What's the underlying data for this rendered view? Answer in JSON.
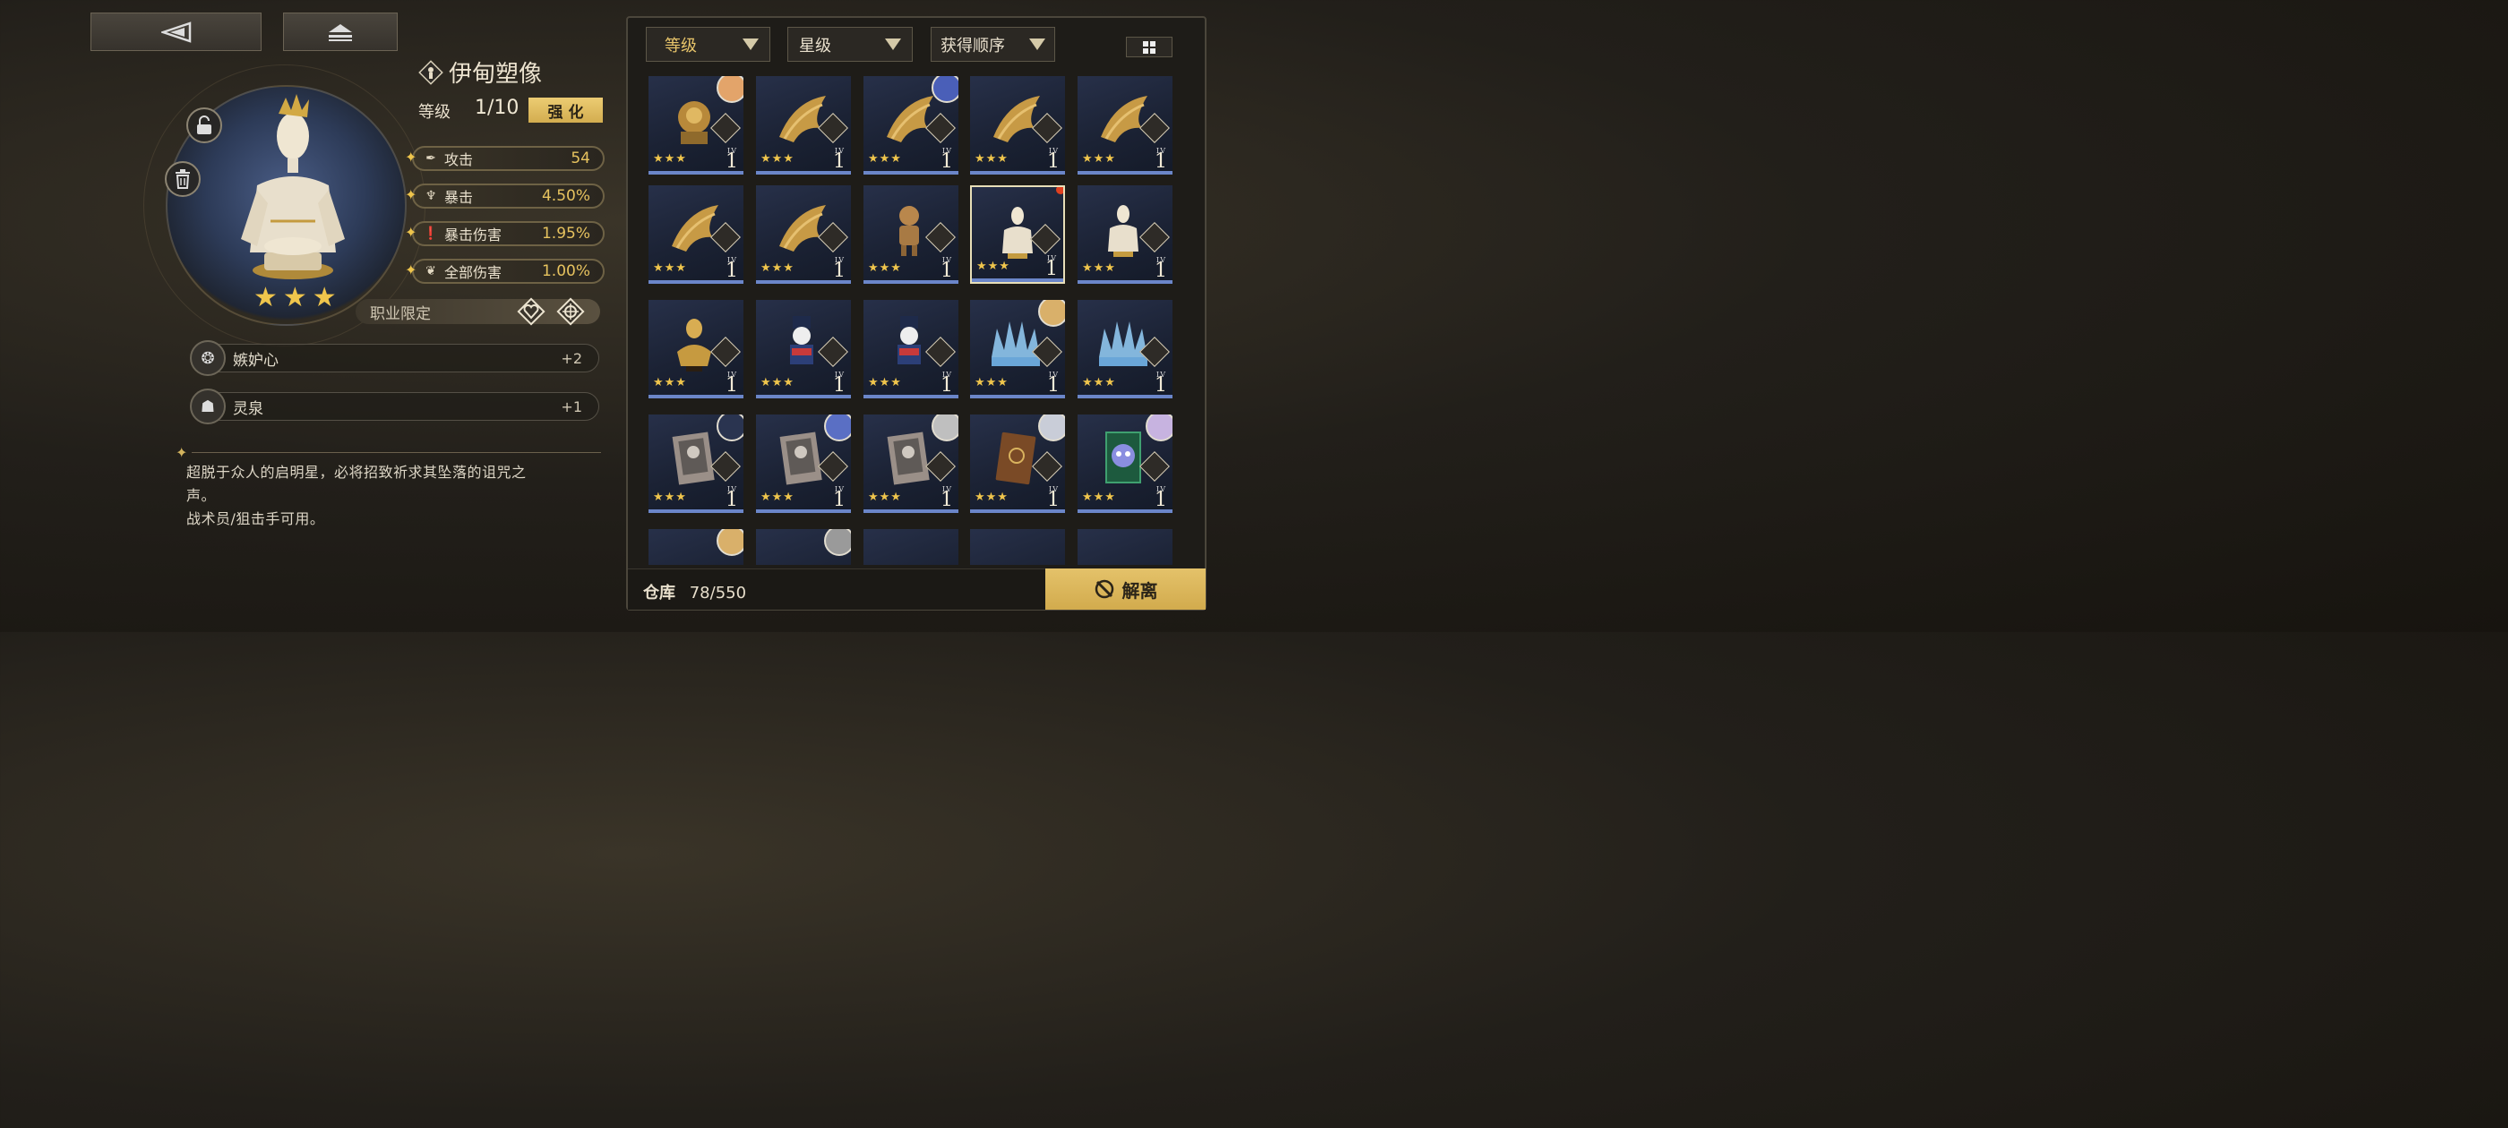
{
  "nav": {
    "back_icon": "triangle-left-icon",
    "home_icon": "eject-icon"
  },
  "item": {
    "name": "伊甸塑像",
    "level_label": "等级",
    "level_value": "1/10",
    "enhance_label": "强 化",
    "stars": 3,
    "stats": [
      {
        "icon": "sword-icon",
        "name": "攻击",
        "value": "54"
      },
      {
        "icon": "crit-icon",
        "name": "暴击",
        "value": "4.50%"
      },
      {
        "icon": "crit-damage-icon",
        "name": "暴击伤害",
        "value": "1.95%"
      },
      {
        "icon": "all-damage-icon",
        "name": "全部伤害",
        "value": "1.00%"
      }
    ],
    "job_label": "职业限定",
    "sub_skills": [
      {
        "icon": "jealous-heart-icon",
        "name": "嫉妒心",
        "value": "+2"
      },
      {
        "icon": "spirit-spring-icon",
        "name": "灵泉",
        "value": "+1"
      }
    ],
    "description_line1": "超脱于众人的启明星，必将招致祈求其坠落的诅咒之",
    "description_line2": "声。",
    "description_line3": "战术员/狙击手可用。"
  },
  "filters": {
    "level": "等级",
    "star": "星级",
    "order": "获得顺序"
  },
  "cards": [
    {
      "art": "gold-lion",
      "avatar": "#e3a46a",
      "stars": "★★★",
      "lv": "1"
    },
    {
      "art": "gold-wings",
      "avatar": "",
      "stars": "★★★",
      "lv": "1"
    },
    {
      "art": "gold-wings",
      "avatar": "#4a5fb8",
      "stars": "★★★",
      "lv": "1"
    },
    {
      "art": "gold-wings",
      "avatar": "",
      "stars": "★★★",
      "lv": "1"
    },
    {
      "art": "gold-wings",
      "avatar": "",
      "stars": "★★★",
      "lv": "1"
    },
    {
      "art": "gold-wings",
      "avatar": "",
      "stars": "★★★",
      "lv": "1"
    },
    {
      "art": "gold-wings",
      "avatar": "",
      "stars": "★★★",
      "lv": "1"
    },
    {
      "art": "puppet",
      "avatar": "",
      "stars": "★★★",
      "lv": "1"
    },
    {
      "art": "mannequin",
      "avatar": "",
      "stars": "★★★",
      "lv": "1",
      "selected": true
    },
    {
      "art": "mannequin",
      "avatar": "",
      "stars": "★★★",
      "lv": "1"
    },
    {
      "art": "gold-bust",
      "avatar": "",
      "stars": "★★★",
      "lv": "1"
    },
    {
      "art": "nutcracker",
      "avatar": "",
      "stars": "★★★",
      "lv": "1"
    },
    {
      "art": "nutcracker",
      "avatar": "",
      "stars": "★★★",
      "lv": "1"
    },
    {
      "art": "ice-crown",
      "avatar": "#d9b06a",
      "stars": "★★★",
      "lv": "1"
    },
    {
      "art": "ice-crown",
      "avatar": "",
      "stars": "★★★",
      "lv": "1"
    },
    {
      "art": "photo",
      "avatar": "#2a3450",
      "stars": "★★★",
      "lv": "1"
    },
    {
      "art": "photo",
      "avatar": "#5a6fc4",
      "stars": "★★★",
      "lv": "1"
    },
    {
      "art": "photo",
      "avatar": "#bfbfbf",
      "stars": "★★★",
      "lv": "1"
    },
    {
      "art": "brown-book",
      "avatar": "#c9cdd8",
      "stars": "★★★",
      "lv": "1"
    },
    {
      "art": "cat-card",
      "avatar": "#c7b3e0",
      "stars": "★★★",
      "lv": "1"
    },
    {
      "art": "partial",
      "avatar": "#d9b06a",
      "stars": "",
      "lv": ""
    },
    {
      "art": "partial",
      "avatar": "#9a9a9a",
      "stars": "",
      "lv": ""
    },
    {
      "art": "partial",
      "avatar": "",
      "stars": "",
      "lv": ""
    },
    {
      "art": "partial",
      "avatar": "",
      "stars": "",
      "lv": ""
    },
    {
      "art": "partial",
      "avatar": "",
      "stars": "",
      "lv": ""
    }
  ],
  "warehouse": {
    "label": "仓库",
    "count": "78/550"
  },
  "dismantle_label": "解离",
  "colors": {
    "accent_gold": "#e4c26a",
    "card_bar": "#6b86c9",
    "star": "#efc54c"
  }
}
